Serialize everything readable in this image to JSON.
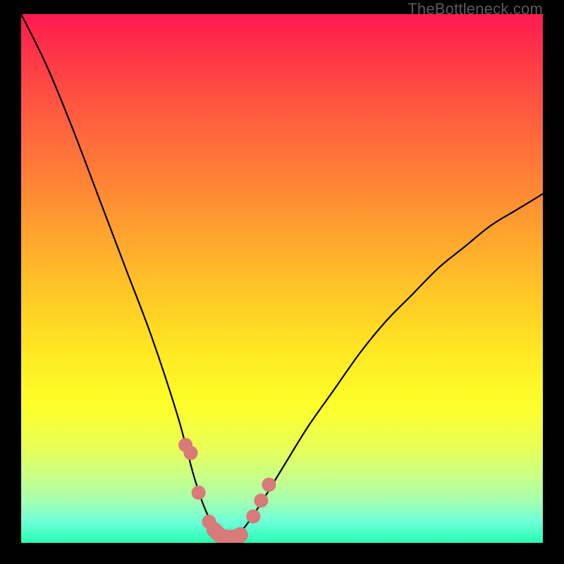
{
  "watermark": "TheBottleneck.com",
  "chart_data": {
    "type": "line",
    "title": "",
    "xlabel": "",
    "ylabel": "",
    "xlim": [
      0,
      100
    ],
    "ylim": [
      0,
      100
    ],
    "series": [
      {
        "name": "bottleneck-curve",
        "x": [
          0,
          5,
          10,
          15,
          20,
          25,
          30,
          33,
          35,
          37,
          39,
          40,
          42,
          45,
          50,
          55,
          60,
          65,
          70,
          75,
          80,
          85,
          90,
          95,
          100
        ],
        "values": [
          100,
          90,
          78,
          65,
          52,
          39,
          24,
          13,
          7,
          3,
          1,
          1,
          2,
          6,
          14,
          22,
          29,
          36,
          42,
          47,
          52,
          56,
          60,
          63,
          66
        ]
      }
    ],
    "markers": {
      "name": "highlighted-points",
      "color": "#d87a78",
      "x": [
        31.5,
        32.5,
        34,
        36,
        37,
        38,
        39,
        40,
        41,
        42,
        44.5,
        46,
        47.5
      ],
      "values": [
        18.5,
        17,
        9.5,
        4,
        2.5,
        1.5,
        1,
        1,
        1,
        1.5,
        5,
        8,
        11
      ]
    },
    "gradient_stops": [
      {
        "pct": 0,
        "color": "#ff1a52"
      },
      {
        "pct": 6,
        "color": "#ff3049"
      },
      {
        "pct": 17,
        "color": "#ff5640"
      },
      {
        "pct": 30,
        "color": "#ff7e36"
      },
      {
        "pct": 42,
        "color": "#ffa52e"
      },
      {
        "pct": 53,
        "color": "#ffc826"
      },
      {
        "pct": 64,
        "color": "#ffe823"
      },
      {
        "pct": 74,
        "color": "#fdff2a"
      },
      {
        "pct": 82,
        "color": "#e8ff56"
      },
      {
        "pct": 87,
        "color": "#ccff82"
      },
      {
        "pct": 92,
        "color": "#a6ffb0"
      },
      {
        "pct": 96,
        "color": "#6effd8"
      },
      {
        "pct": 100,
        "color": "#25ffb4"
      }
    ]
  }
}
